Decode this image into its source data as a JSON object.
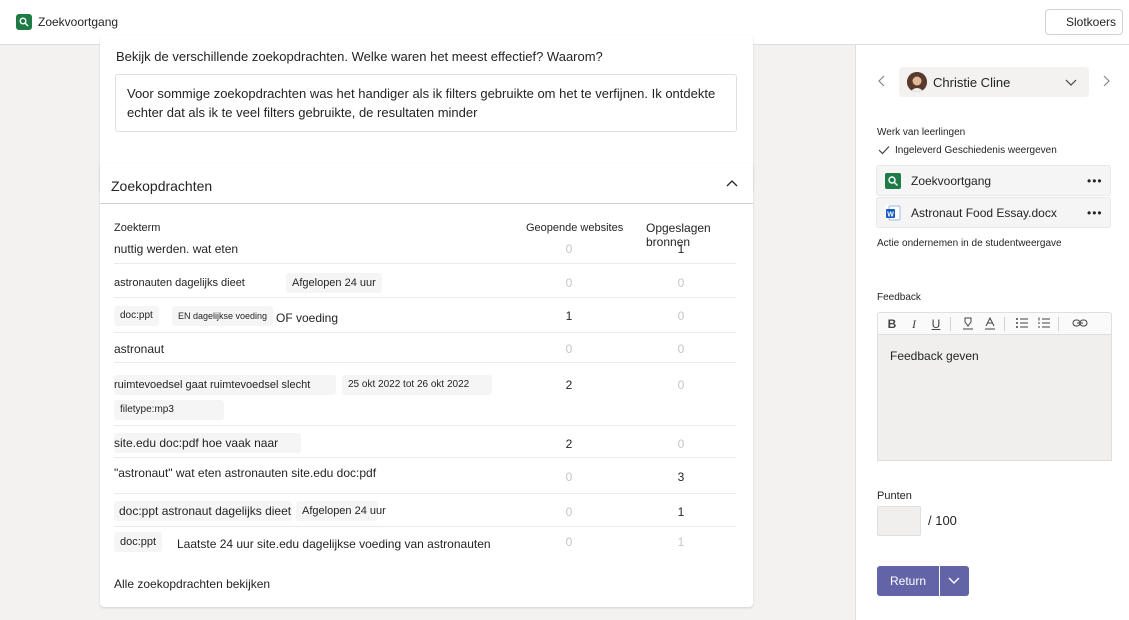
{
  "header": {
    "app_title": "Zoekvoortgang",
    "close_button": "Slotkoers"
  },
  "question_card": {
    "question": "Bekijk de verschillende zoekopdrachten. Welke waren het meest effectief? Waarom?",
    "answer_line1": "Voor sommige zoekopdrachten was het handiger als ik filters gebruikte om het te verfijnen. Ik ontdekte",
    "answer_line2": "echter dat als ik te veel filters gebruikte, de resultaten minder"
  },
  "searches_card": {
    "title": "Zoekopdrachten",
    "col_term": "Zoekterm",
    "col_sites": "Geopende websites",
    "col_saved": "Opgeslagen bronnen",
    "all_link": "Alle zoekopdrachten bekijken",
    "rows": [
      {
        "t1": "nuttig werden. wat eten",
        "sites": "0",
        "saved": "1"
      },
      {
        "t1": "astronauten dagelijks dieet",
        "chip1": "Afgelopen 24 uur",
        "sites": "0",
        "saved": "0"
      },
      {
        "c1": "doc:ppt",
        "chip1": "EN dagelijkse voeding",
        "t2": "OF voeding",
        "sites": "1",
        "saved": "0"
      },
      {
        "t1": "astronaut",
        "sites": "0",
        "saved": "0"
      },
      {
        "t1": "ruimtevoedsel gaat ruimtevoedsel slecht",
        "chip1": "25 okt 2022 tot 26 okt 2022",
        "chip2": "filetype:mp3",
        "sites": "2",
        "saved": "0"
      },
      {
        "t1": "site.edu doc:pdf hoe vaak naar",
        "sites": "2",
        "saved": "0"
      },
      {
        "t1": "\"astronaut\" wat eten astronauten site.edu doc:pdf",
        "sites": "0",
        "saved": "3"
      },
      {
        "t1": "doc:ppt astronaut dagelijks dieet",
        "chip1": "Afgelopen 24 uur",
        "sites": "0",
        "saved": "1"
      },
      {
        "c1": "doc:ppt",
        "t2": "Laatste 24 uur site.edu dagelijkse voeding van astronauten",
        "sites": "0",
        "saved": "1"
      }
    ]
  },
  "panel": {
    "student_name": "Christie Cline",
    "work_label": "Werk van leerlingen",
    "status": "Ingeleverd  Geschiedenis weergeven",
    "file1": "Zoekvoortgang",
    "file2": "Astronaut Food Essay.docx",
    "more": "•••",
    "action_label": "Actie ondernemen in de studentweergave",
    "feedback_label": "Feedback",
    "feedback_placeholder": "Feedback geven",
    "points_label": "Punten",
    "points_max": "/ 100",
    "return_label": "Return",
    "toolbar": {
      "bold": "B",
      "italic": "I",
      "underline": "U"
    }
  },
  "colors": {
    "accent": "#6264a7",
    "app_green": "#1e7b45",
    "word_blue": "#185abd"
  }
}
